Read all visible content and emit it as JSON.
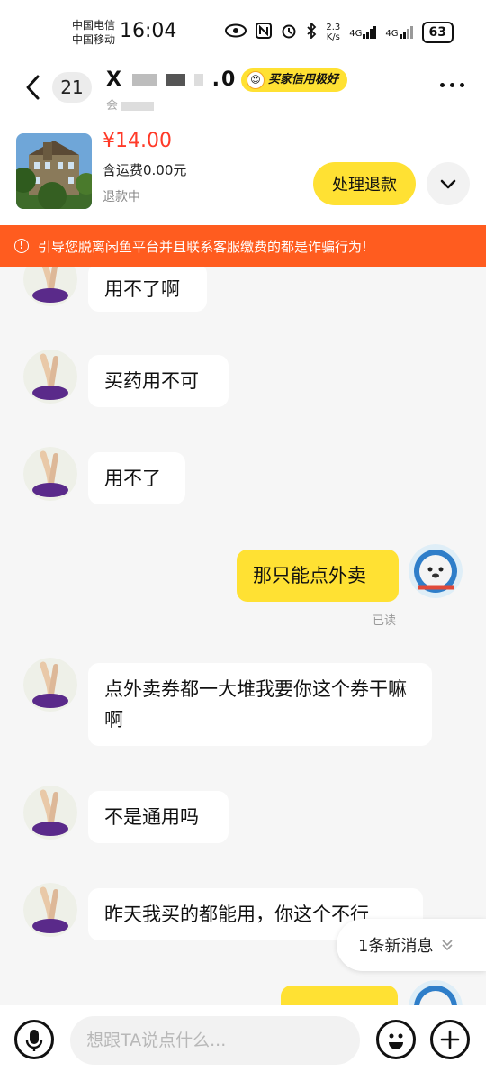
{
  "status_bar": {
    "carrier_1": "中国电信",
    "carrier_2": "中国移动",
    "time": "16:04",
    "net_speed": "2.3",
    "net_speed_unit": "K/s",
    "network_1": "4G",
    "network_2": "4G",
    "battery": "63"
  },
  "header": {
    "unread_count": "21",
    "seller_name_start": "X",
    "seller_name_end": ".0",
    "seller_subtitle": "会",
    "credit_badge": "买家信用极好"
  },
  "product": {
    "price": "¥14.00",
    "shipping": "含运费0.00元",
    "status": "退款中",
    "action_label": "处理退款"
  },
  "warning": {
    "text": "引导您脱离闲鱼平台并且联系客服缴费的都是诈骗行为!"
  },
  "messages": [
    {
      "from": "other",
      "text": "用不了啊"
    },
    {
      "from": "other",
      "text": "买药用不可"
    },
    {
      "from": "other",
      "text": "用不了"
    },
    {
      "from": "me",
      "text": "那只能点外卖",
      "receipt": "已读"
    },
    {
      "from": "other",
      "text": "点外卖券都一大堆我要你这个券干嘛啊"
    },
    {
      "from": "other",
      "text": "不是通用吗"
    },
    {
      "from": "other",
      "text": "昨天我买的都能用，你这个不行"
    }
  ],
  "new_messages": "1条新消息",
  "input": {
    "placeholder": "想跟TA说点什么..."
  },
  "colors": {
    "accent_yellow": "#ffe133",
    "warning_orange": "#ff5c1f",
    "price_red": "#ff3a28"
  }
}
